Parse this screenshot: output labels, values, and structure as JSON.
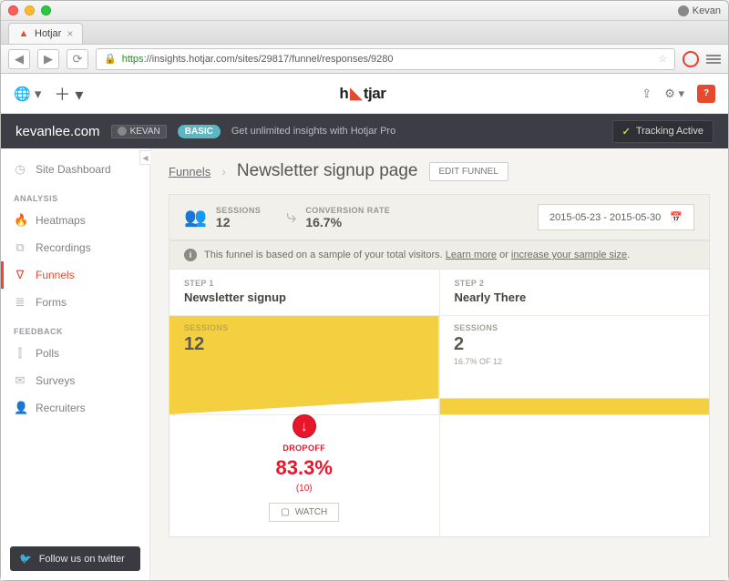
{
  "window": {
    "profile": "Kevan"
  },
  "browser": {
    "tab_title": "Hotjar",
    "url_https": "https",
    "url_rest": "://insights.hotjar.com/sites/29817/funnel/responses/9280",
    "bell_count": "?"
  },
  "topbar": {
    "logo": "hotjar"
  },
  "sitebar": {
    "domain": "kevanlee.com",
    "role": "KEVAN",
    "plan": "BASIC",
    "upsell": "Get unlimited insights with Hotjar Pro",
    "tracking": "Tracking Active"
  },
  "sidebar": {
    "items": [
      {
        "icon": "◷",
        "label": "Site Dashboard"
      }
    ],
    "analysis_header": "ANALYSIS",
    "analysis": [
      {
        "icon": "🔥",
        "label": "Heatmaps"
      },
      {
        "icon": "⧉",
        "label": "Recordings"
      },
      {
        "icon": "∇",
        "label": "Funnels",
        "active": true
      },
      {
        "icon": "≣",
        "label": "Forms"
      }
    ],
    "feedback_header": "FEEDBACK",
    "feedback": [
      {
        "icon": "⫿",
        "label": "Polls"
      },
      {
        "icon": "✉",
        "label": "Surveys"
      },
      {
        "icon": "👤",
        "label": "Recruiters"
      }
    ],
    "twitter": "Follow us on twitter"
  },
  "breadcrumb": {
    "root": "Funnels",
    "title": "Newsletter signup page",
    "edit": "EDIT FUNNEL"
  },
  "stats": {
    "sessions_label": "SESSIONS",
    "sessions_value": "12",
    "conv_label": "CONVERSION RATE",
    "conv_value": "16.7%",
    "date_range": "2015-05-23 - 2015-05-30"
  },
  "info": {
    "text": "This funnel is based on a sample of your total visitors.",
    "learn": "Learn more",
    "or": " or ",
    "increase": "increase your sample size",
    "dot": "."
  },
  "steps": [
    {
      "label": "STEP 1",
      "name": "Newsletter signup",
      "sessions_label": "SESSIONS",
      "sessions": "12",
      "sub": ""
    },
    {
      "label": "STEP 2",
      "name": "Nearly There",
      "sessions_label": "SESSIONS",
      "sessions": "2",
      "sub": "16.7% OF 12"
    }
  ],
  "dropoff": {
    "label": "DROPOFF",
    "pct": "83.3%",
    "count": "(10)",
    "watch": "WATCH"
  }
}
